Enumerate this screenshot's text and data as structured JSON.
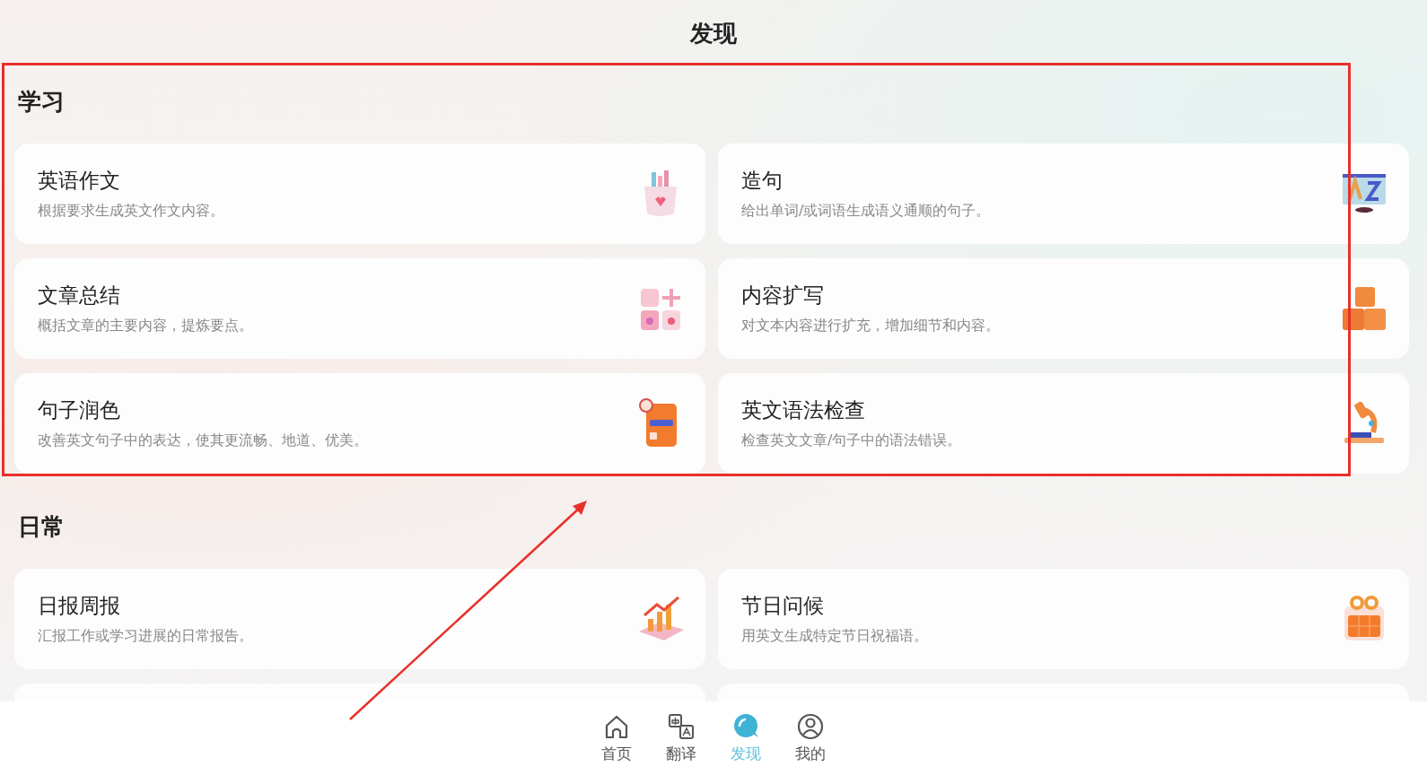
{
  "page_title": "发现",
  "sections": [
    {
      "title": "学习",
      "cards": [
        {
          "title": "英语作文",
          "description": "根据要求生成英文作文内容。"
        },
        {
          "title": "造句",
          "description": "给出单词/或词语生成语义通顺的句子。"
        },
        {
          "title": "文章总结",
          "description": "概括文章的主要内容，提炼要点。"
        },
        {
          "title": "内容扩写",
          "description": "对文本内容进行扩充，增加细节和内容。"
        },
        {
          "title": "句子润色",
          "description": "改善英文句子中的表达，使其更流畅、地道、优美。"
        },
        {
          "title": "英文语法检查",
          "description": "检查英文文章/句子中的语法错误。"
        }
      ]
    },
    {
      "title": "日常",
      "cards": [
        {
          "title": "日报周报",
          "description": "汇报工作或学习进展的日常报告。"
        },
        {
          "title": "节日问候",
          "description": "用英文生成特定节日祝福语。"
        }
      ]
    }
  ],
  "bottom_nav": [
    {
      "label": "首页",
      "selected": false
    },
    {
      "label": "翻译",
      "selected": false
    },
    {
      "label": "发现",
      "selected": true
    },
    {
      "label": "我的",
      "selected": false
    }
  ]
}
